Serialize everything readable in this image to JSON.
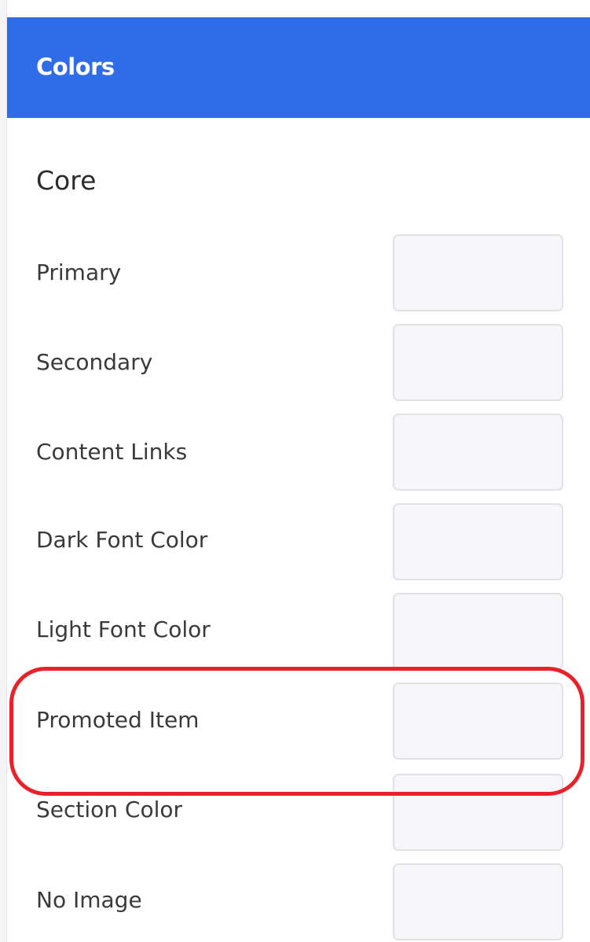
{
  "header": {
    "title": "Colors",
    "color": "#2f6ce5"
  },
  "section": {
    "title": "Core"
  },
  "rows": [
    {
      "label": "Primary"
    },
    {
      "label": "Secondary"
    },
    {
      "label": "Content Links"
    },
    {
      "label": "Dark Font Color"
    },
    {
      "label": "Light Font Color"
    },
    {
      "label": "Promoted Item"
    },
    {
      "label": "Section Color"
    },
    {
      "label": "No Image"
    }
  ],
  "annotation": {
    "color": "#e8222b"
  }
}
